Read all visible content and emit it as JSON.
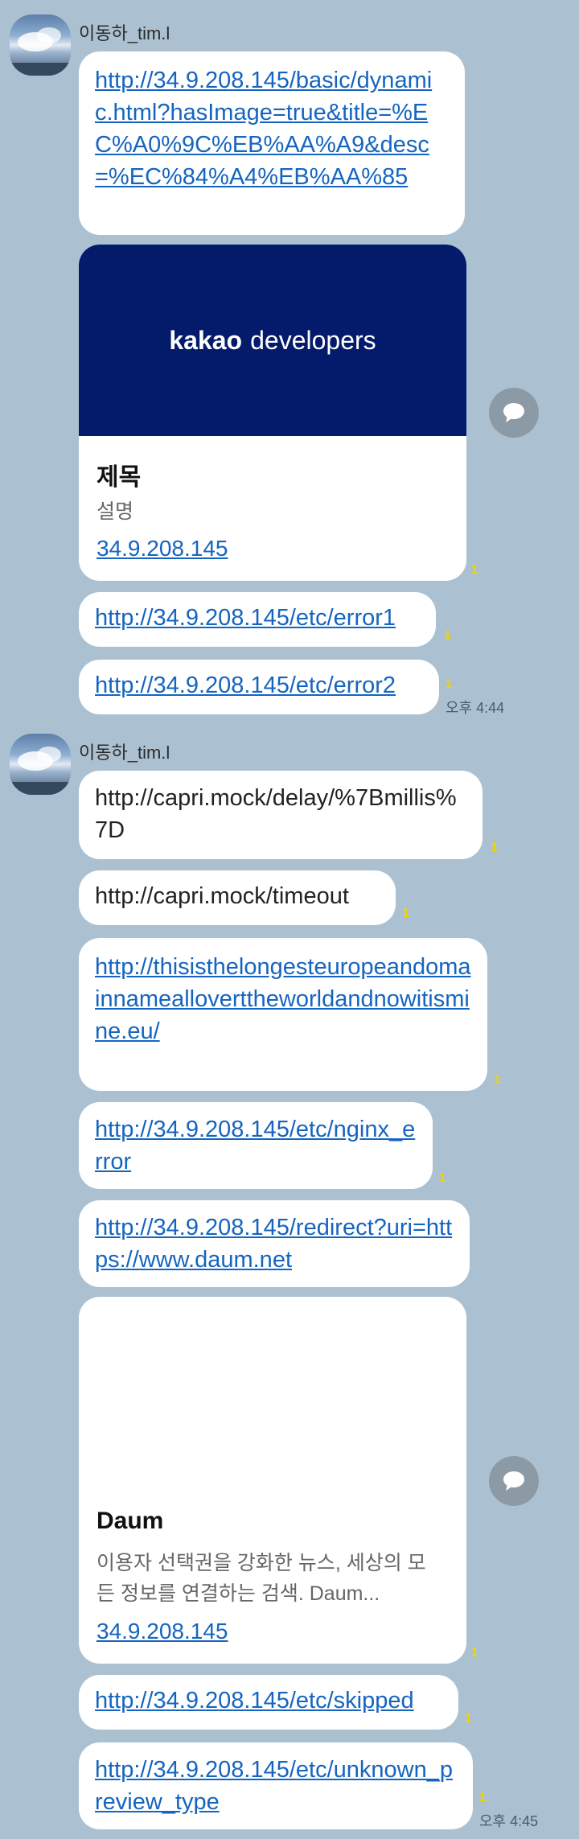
{
  "chat": {
    "sender": "이동하_tim.l",
    "group1": {
      "msg1": "http://34.9.208.145/basic/dynamic.html?hasImage=true&title=%EC%A0%9C%EB%AA%A9&desc=%EC%84%A4%EB%AA%85",
      "card1": {
        "banner_bold": "kakao",
        "banner_light": "developers",
        "title": "제목",
        "desc": "설명",
        "link": "34.9.208.145"
      },
      "msg2": "http://34.9.208.145/etc/error1",
      "msg3": "http://34.9.208.145/etc/error2",
      "unread": "1",
      "time": "오후 4:44"
    },
    "group2": {
      "msg1": "http://capri.mock/delay/%7Bmillis%7D",
      "msg2": "http://capri.mock/timeout",
      "msg3": "http://thisisthelongesteuropeandomainnamealloverttheworldandnowitismine.eu/",
      "msg4": "http://34.9.208.145/etc/nginx_error",
      "msg5": "http://34.9.208.145/redirect?uri=https://www.daum.net",
      "card2": {
        "title": "Daum",
        "desc": "이용자 선택권을 강화한 뉴스, 세상의 모든 정보를 연결하는 검색. Daum...",
        "link": "34.9.208.145"
      },
      "msg6": "http://34.9.208.145/etc/skipped",
      "msg7": "http://34.9.208.145/etc/unknown_preview_type",
      "unread": "1",
      "time": "오후 4:45"
    }
  },
  "icons": {
    "avatar": "profile-photo-sky",
    "share": "speech-bubble-icon"
  },
  "colors": {
    "background": "#abc1d1",
    "link": "#1565c0",
    "unread": "#f0d400",
    "banner": "#041a6b"
  }
}
